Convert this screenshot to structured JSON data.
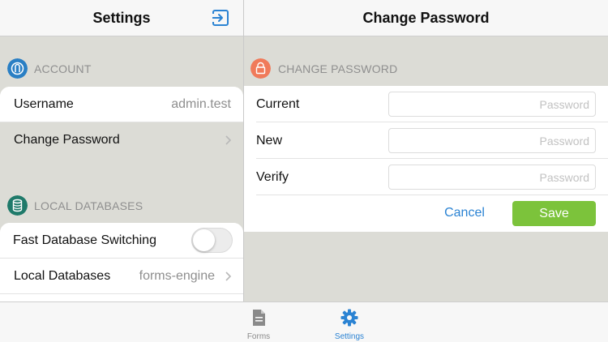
{
  "left_pane": {
    "title": "Settings",
    "account_section": {
      "header": "ACCOUNT",
      "rows": [
        {
          "label": "Username",
          "value": "admin.test"
        },
        {
          "label": "Change Password"
        }
      ]
    },
    "databases_section": {
      "header": "LOCAL DATABASES",
      "rows": [
        {
          "label": "Fast Database Switching",
          "toggle_on": false
        },
        {
          "label": "Local Databases",
          "value": "forms-engine"
        }
      ]
    }
  },
  "right_pane": {
    "title": "Change Password",
    "section_header": "CHANGE PASSWORD",
    "fields": [
      {
        "label": "Current",
        "placeholder": "Password",
        "value": ""
      },
      {
        "label": "New",
        "placeholder": "Password",
        "value": ""
      },
      {
        "label": "Verify",
        "placeholder": "Password",
        "value": ""
      }
    ],
    "cancel_label": "Cancel",
    "save_label": "Save"
  },
  "tabbar": {
    "tabs": [
      {
        "label": "Forms",
        "icon": "document-icon",
        "active": false
      },
      {
        "label": "Settings",
        "icon": "gear-icon",
        "active": true
      }
    ]
  },
  "colors": {
    "accent_blue": "#2b83d3",
    "save_green": "#7cc33b",
    "account_icon_blue": "#2a7fc4",
    "database_icon_teal": "#1f7a6a",
    "lock_icon_orange": "#f07a5a",
    "inactive_tab_gray": "#8a8a8a"
  }
}
